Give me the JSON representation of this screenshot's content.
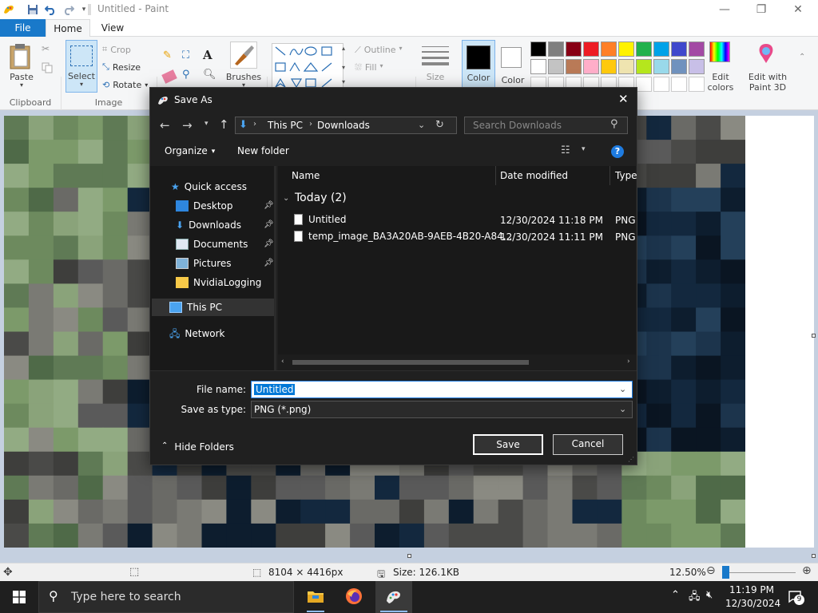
{
  "titlebar": {
    "title": "Untitled - Paint",
    "save_icon": "save-icon",
    "undo_icon": "undo-icon",
    "redo_icon": "redo-icon",
    "minimize": "—",
    "maximize": "❐",
    "close": "✕"
  },
  "tabs": {
    "file": "File",
    "home": "Home",
    "view": "View"
  },
  "ribbon": {
    "paste": "Paste",
    "clipboard": "Clipboard",
    "select": "Select",
    "crop": "Crop",
    "resize": "Resize",
    "rotate": "Rotate",
    "image": "Image",
    "brushes": "Brushes",
    "outline": "Outline",
    "fill": "Fill",
    "size": "Size",
    "color1": "Color\n1",
    "color2": "Color\n2",
    "color1_short": "Color",
    "color2_short": "Color",
    "edit_colors": "Edit colors",
    "edit_with_paint3d": "Edit with Paint 3D",
    "palette_row1": [
      "#000000",
      "#7f7f7f",
      "#880015",
      "#ed1c24",
      "#ff7f27",
      "#fff200",
      "#22b14c",
      "#00a2e8",
      "#3f48cc",
      "#a349a4"
    ],
    "palette_row2": [
      "#ffffff",
      "#c3c3c3",
      "#b97a57",
      "#ffaec9",
      "#ffc90e",
      "#efe4b0",
      "#b5e61d",
      "#99d9ea",
      "#7092be",
      "#c8bfe7"
    ]
  },
  "dialog": {
    "title": "Save As",
    "breadcrumb": [
      "This PC",
      "Downloads"
    ],
    "search_placeholder": "Search Downloads",
    "organize": "Organize",
    "new_folder": "New folder",
    "columns": {
      "name": "Name",
      "date": "Date modified",
      "type": "Type"
    },
    "group": "Today (2)",
    "files": [
      {
        "name": "Untitled",
        "date": "12/30/2024 11:18 PM",
        "type": "PNG"
      },
      {
        "name": "temp_image_BA3A20AB-9AEB-4B20-A84...",
        "date": "12/30/2024 11:11 PM",
        "type": "PNG"
      }
    ],
    "nav": {
      "quick_access": "Quick access",
      "desktop": "Desktop",
      "downloads": "Downloads",
      "documents": "Documents",
      "pictures": "Pictures",
      "nvidia": "NvidiaLogging",
      "this_pc": "This PC",
      "network": "Network"
    },
    "file_name_label": "File name:",
    "file_name_value": "Untitled",
    "save_type_label": "Save as type:",
    "save_type_value": "PNG (*.png)",
    "hide_folders": "Hide Folders",
    "save": "Save",
    "cancel": "Cancel"
  },
  "status": {
    "dimensions": "8104 × 4416px",
    "size": "Size: 126.1KB",
    "zoom": "12.50%",
    "zoom_level": 0.125
  },
  "taskbar": {
    "search_placeholder": "Type here to search",
    "time": "11:19 PM",
    "date": "12/30/2024",
    "notification_count": "9"
  }
}
